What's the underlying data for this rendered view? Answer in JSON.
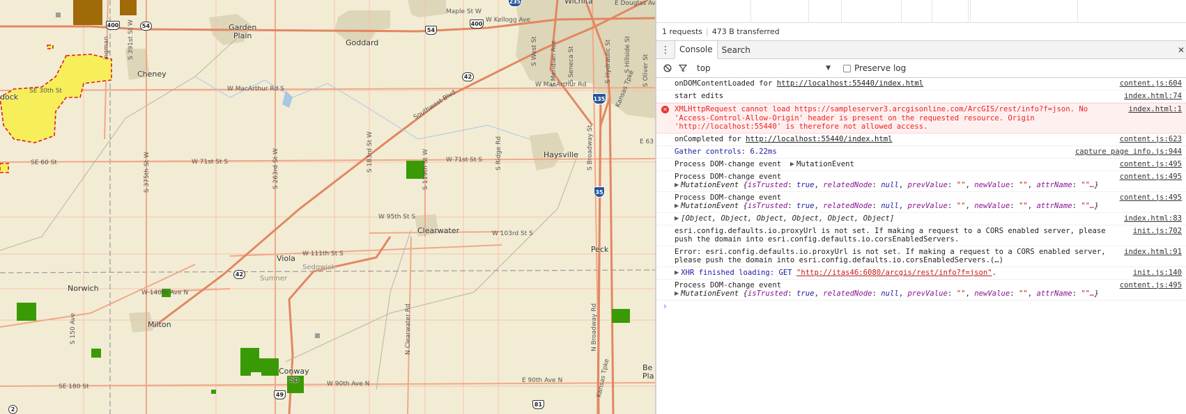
{
  "map": {
    "places": [
      {
        "id": "garden-plain",
        "text": "Garden\nPlain"
      },
      {
        "id": "goddard",
        "text": "Goddard"
      },
      {
        "id": "cheney",
        "text": "Cheney"
      },
      {
        "id": "haysville",
        "text": "Haysville"
      },
      {
        "id": "clearwater",
        "text": "Clearwater"
      },
      {
        "id": "peck",
        "text": "Peck"
      },
      {
        "id": "viola",
        "text": "Viola"
      },
      {
        "id": "norwich",
        "text": "Norwich"
      },
      {
        "id": "milton",
        "text": "Milton"
      },
      {
        "id": "conway-springs",
        "text": "Conway\nSp"
      },
      {
        "id": "wichita",
        "text": "Wichita"
      },
      {
        "id": "kingman",
        "text": "dock"
      },
      {
        "id": "belle-plaine",
        "text": "Be\nPla"
      },
      {
        "id": "sedgwick",
        "text": "Sedgwick"
      },
      {
        "id": "sumner",
        "text": "Sumner"
      }
    ],
    "roads": [
      {
        "id": "maple",
        "text": "Maple St W"
      },
      {
        "id": "kellogg",
        "text": "W Kellogg Ave"
      },
      {
        "id": "douglas",
        "text": "E Douglas Av"
      },
      {
        "id": "macarthur-w",
        "text": "W MacArthur Rd S"
      },
      {
        "id": "macarthur-e",
        "text": "W MacArthur Rd"
      },
      {
        "id": "se30",
        "text": "SE 30th St"
      },
      {
        "id": "se60",
        "text": "SE 60 St"
      },
      {
        "id": "w71-a",
        "text": "W 71st St S"
      },
      {
        "id": "w71-b",
        "text": "W 71st St S"
      },
      {
        "id": "w95",
        "text": "W 95th St S"
      },
      {
        "id": "w103",
        "text": "W 103rd St S"
      },
      {
        "id": "w111",
        "text": "W 111th St S"
      },
      {
        "id": "w140",
        "text": "W 140th Ave N"
      },
      {
        "id": "se180",
        "text": "SE 180 St"
      },
      {
        "id": "w90",
        "text": "W 90th Ave N"
      },
      {
        "id": "e90",
        "text": "E 90th Ave N"
      },
      {
        "id": "e63",
        "text": "E 63"
      },
      {
        "id": "southwest",
        "text": "Southwest Blvd"
      },
      {
        "id": "s391",
        "text": "S 391st St W"
      },
      {
        "id": "s375",
        "text": "S 375th St W"
      },
      {
        "id": "s263",
        "text": "S 263rd St W"
      },
      {
        "id": "s183",
        "text": "S 183rd St W"
      },
      {
        "id": "s119",
        "text": "S 119th St W"
      },
      {
        "id": "ridge",
        "text": "S Ridge Rd"
      },
      {
        "id": "west",
        "text": "S West St"
      },
      {
        "id": "meridian",
        "text": "S Meridian Ave"
      },
      {
        "id": "seneca",
        "text": "S Seneca St"
      },
      {
        "id": "broadway",
        "text": "S Broadway St"
      },
      {
        "id": "hydraulic",
        "text": "S Hydraulic St"
      },
      {
        "id": "hillside",
        "text": "S Hillside St"
      },
      {
        "id": "oliver",
        "text": "S Oliver St"
      },
      {
        "id": "kansas-tpk",
        "text": "Kansas Tpke"
      },
      {
        "id": "kansas-tpk2",
        "text": "Kansas Tpke"
      },
      {
        "id": "s150",
        "text": "S 150 Ave"
      },
      {
        "id": "n-clearwater",
        "text": "N Clearwater Rd"
      },
      {
        "id": "n-broadway",
        "text": "N Broadway Rd"
      },
      {
        "id": "kingman-rd",
        "text": "ingman"
      }
    ],
    "shields": [
      {
        "id": "us400-a",
        "text": "400"
      },
      {
        "id": "ks54-a",
        "text": "54"
      },
      {
        "id": "us54",
        "text": "54"
      },
      {
        "id": "us400-b",
        "text": "400"
      },
      {
        "id": "i235",
        "text": "235"
      },
      {
        "id": "ks42-a",
        "text": "42"
      },
      {
        "id": "i135",
        "text": "135"
      },
      {
        "id": "i35",
        "text": "35"
      },
      {
        "id": "ks42-b",
        "text": "42"
      },
      {
        "id": "ks49",
        "text": "49"
      },
      {
        "id": "us81",
        "text": "81"
      },
      {
        "id": "ks2",
        "text": "2"
      }
    ],
    "colors": {
      "base": "#f2ecd5",
      "road": "#f0a887",
      "highway": "#e28761",
      "urban": "#ddd6b8",
      "fire": "#f7ef5a",
      "fire_border": "#e21a1a",
      "green": "#3a9a06",
      "brown": "#a06a08"
    }
  },
  "devtools": {
    "summary": {
      "requests": "1 requests",
      "transferred": "473 B transferred"
    },
    "tabs": [
      {
        "label": "Console",
        "active": true
      },
      {
        "label": "Search",
        "active": false
      }
    ],
    "toolbar": {
      "context": "top",
      "preserve_log": "Preserve log"
    },
    "messages": [
      {
        "text": "onDOMContentLoaded for ",
        "link": "http://localhost:55440/index.html",
        "source": "content.js:604"
      },
      {
        "text": "start edits",
        "source": "index.html:74"
      },
      {
        "text": "XMLHttpRequest cannot load https://sampleserver3.arcgisonline.com/ArcGIS/rest/info?f=json. No 'Access-Control-Allow-Origin' header is present on the requested resource. Origin 'http://localhost:55440' is therefore not allowed access.",
        "source": "index.html:1"
      },
      {
        "text": "onCompleted for ",
        "link": "http://localhost:55440/index.html",
        "source": "content.js:623"
      },
      {
        "text": "Gather controls: 6.22ms",
        "source": "capture page info.js:944"
      },
      {
        "text": "Process DOM-change event  ",
        "obj": "MutationEvent",
        "source": "content.js:495"
      },
      {
        "text": "Process DOM-change event",
        "source": "content.js:495"
      },
      {
        "text": "Process DOM-change event",
        "source": "content.js:495"
      },
      {
        "text": "[Object, Object, Object, Object, Object, Object]",
        "source": "index.html:83"
      },
      {
        "text": "esri.config.defaults.io.proxyUrl is not set. If making a request to a CORS enabled server, please push the domain into esri.config.defaults.io.corsEnabledServers.",
        "source": "init.js:702"
      },
      {
        "text": "Error: esri.config.defaults.io.proxyUrl is not set. If making a request to a CORS enabled server, please push the domain into esri.config.defaults.io.corsEnabledServers.(…)",
        "source": "index.html:91"
      },
      {
        "label": "XHR finished loading: GET ",
        "url": "\"http://itas46:6080/arcgis/rest/info?f=json\"",
        "end": ".",
        "source": "init.js:140"
      },
      {
        "text": "Process DOM-change event",
        "source": "content.js:495"
      }
    ],
    "mutation_event": {
      "name": "MutationEvent",
      "k1": "isTrusted",
      "v1": "true",
      "k2": "relatedNode",
      "v2": "null",
      "k3": "prevValue",
      "v3": "\"\"",
      "k4": "newValue",
      "v4": "\"\"",
      "k5": "attrName",
      "v5": "\"\"…"
    }
  }
}
